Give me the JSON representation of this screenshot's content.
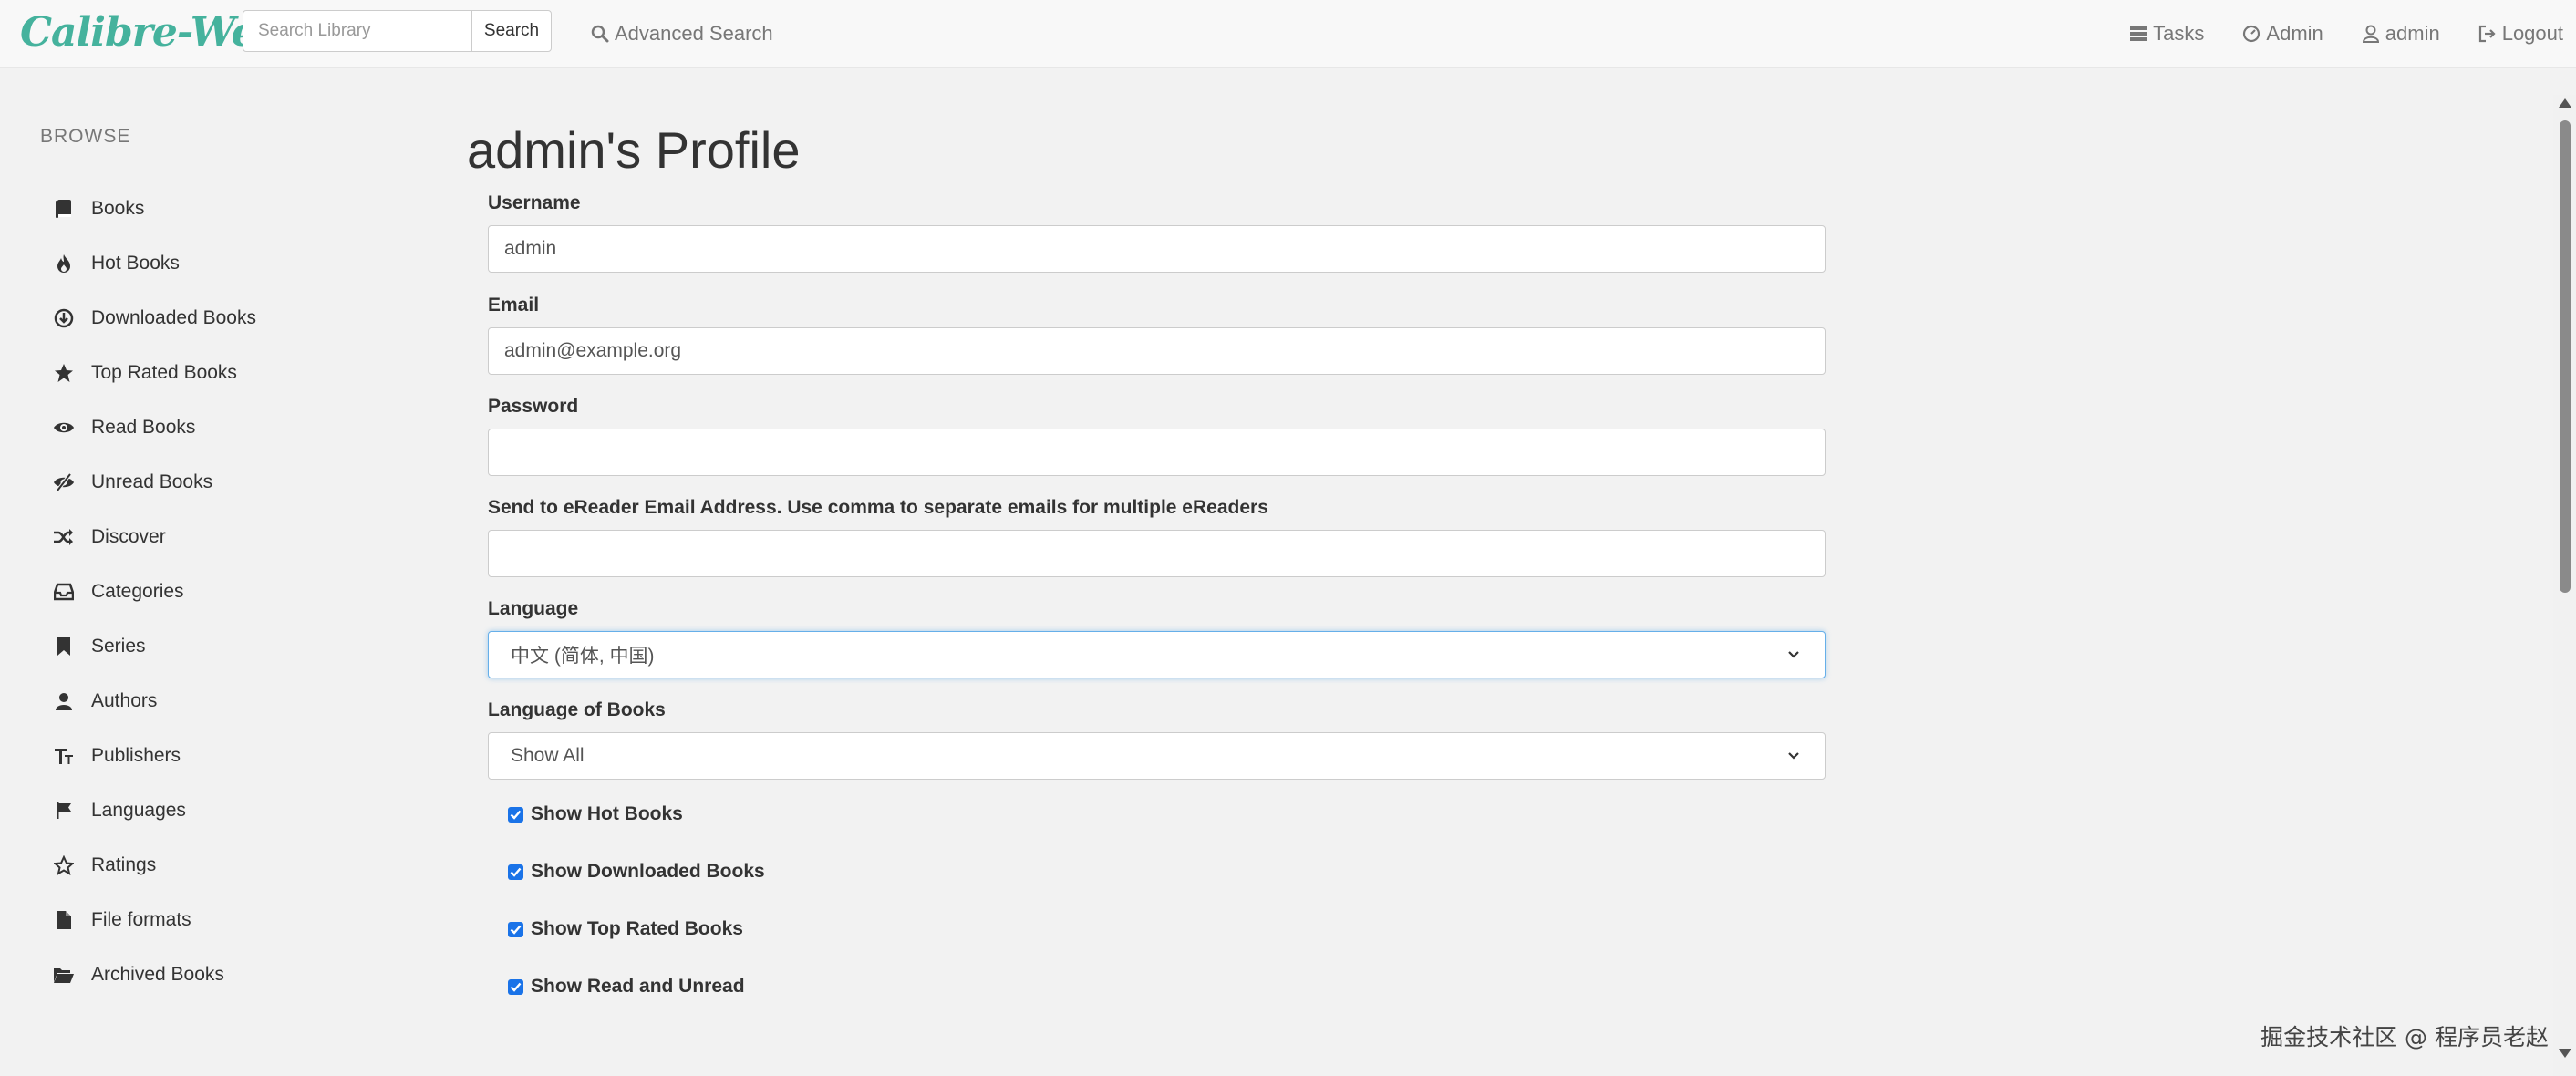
{
  "navbar": {
    "brand": "Calibre-Web",
    "search_placeholder": "Search Library",
    "search_button": "Search",
    "advanced_search": "Advanced Search",
    "tasks": "Tasks",
    "admin": "Admin",
    "user": "admin",
    "logout": "Logout"
  },
  "sidebar": {
    "title": "BROWSE",
    "items": [
      {
        "label": "Books",
        "icon": "book-icon"
      },
      {
        "label": "Hot Books",
        "icon": "fire-icon"
      },
      {
        "label": "Downloaded Books",
        "icon": "download-circle-icon"
      },
      {
        "label": "Top Rated Books",
        "icon": "star-icon"
      },
      {
        "label": "Read Books",
        "icon": "eye-icon"
      },
      {
        "label": "Unread Books",
        "icon": "eye-slash-icon"
      },
      {
        "label": "Discover",
        "icon": "shuffle-icon"
      },
      {
        "label": "Categories",
        "icon": "inbox-icon"
      },
      {
        "label": "Series",
        "icon": "bookmark-icon"
      },
      {
        "label": "Authors",
        "icon": "user-icon"
      },
      {
        "label": "Publishers",
        "icon": "text-size-icon"
      },
      {
        "label": "Languages",
        "icon": "flag-icon"
      },
      {
        "label": "Ratings",
        "icon": "star-outline-icon"
      },
      {
        "label": "File formats",
        "icon": "file-icon"
      },
      {
        "label": "Archived Books",
        "icon": "folder-open-icon"
      }
    ]
  },
  "profile": {
    "title": "admin's Profile",
    "username_label": "Username",
    "username_value": "admin",
    "email_label": "Email",
    "email_value": "admin@example.org",
    "password_label": "Password",
    "password_value": "",
    "ereader_label": "Send to eReader Email Address. Use comma to separate emails for multiple eReaders",
    "ereader_value": "",
    "language_label": "Language",
    "language_value": "中文 (简体, 中国)",
    "book_language_label": "Language of Books",
    "book_language_value": "Show All",
    "checkboxes": [
      {
        "label": "Show Hot Books",
        "checked": true
      },
      {
        "label": "Show Downloaded Books",
        "checked": true
      },
      {
        "label": "Show Top Rated Books",
        "checked": true
      },
      {
        "label": "Show Read and Unread",
        "checked": true
      }
    ]
  },
  "credit": "掘金技术社区 @ 程序员老赵",
  "colors": {
    "brand": "#45b29d",
    "checkbox": "#1a73e8",
    "focus": "#66afe9"
  }
}
